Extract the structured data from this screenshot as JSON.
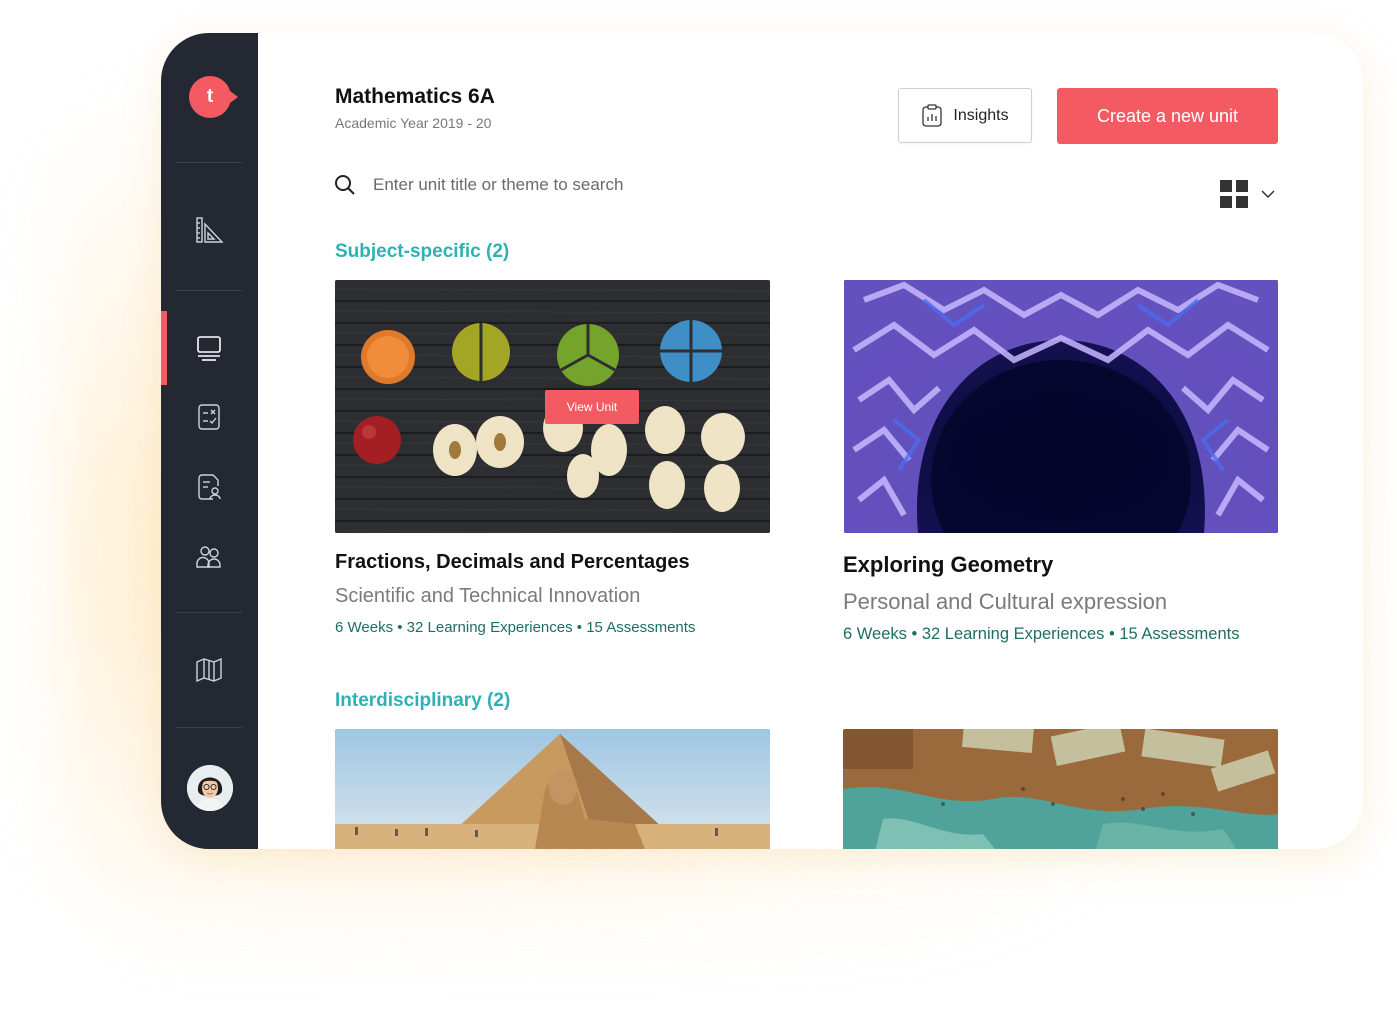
{
  "course": {
    "title": "Mathematics 6A",
    "subtitle": "Academic Year 2019 - 20"
  },
  "header": {
    "insights_label": "Insights",
    "create_label": "Create a new unit"
  },
  "search": {
    "placeholder": "Enter unit title or theme to search"
  },
  "sidebar": {
    "items": [
      {
        "icon": "ruler-triangle-icon"
      },
      {
        "icon": "monitor-icon",
        "active": true
      },
      {
        "icon": "assessment-sheet-icon"
      },
      {
        "icon": "student-file-icon"
      },
      {
        "icon": "users-icon"
      },
      {
        "icon": "book-map-icon"
      }
    ]
  },
  "sections": [
    {
      "heading": "Subject-specific (2)",
      "cards": [
        {
          "title": "Fractions, Decimals and Percentages",
          "theme": "Scientific and Technical Innovation",
          "meta": "6 Weeks • 32 Learning Experiences • 15 Assessments",
          "hover_button": "View Unit"
        },
        {
          "title": "Exploring Geometry",
          "theme": "Personal and Cultural expression",
          "meta": "6 Weeks • 32 Learning Experiences • 15 Assessments"
        }
      ]
    },
    {
      "heading": "Interdisciplinary (2)",
      "cards": [
        {
          "image": "pyramid-sphinx"
        },
        {
          "image": "world-map-money"
        }
      ]
    }
  ],
  "colors": {
    "accent": "#f45a62",
    "teal": "#2fb1b4",
    "meta_green": "#1e6e63",
    "sidebar_bg": "#242833"
  }
}
